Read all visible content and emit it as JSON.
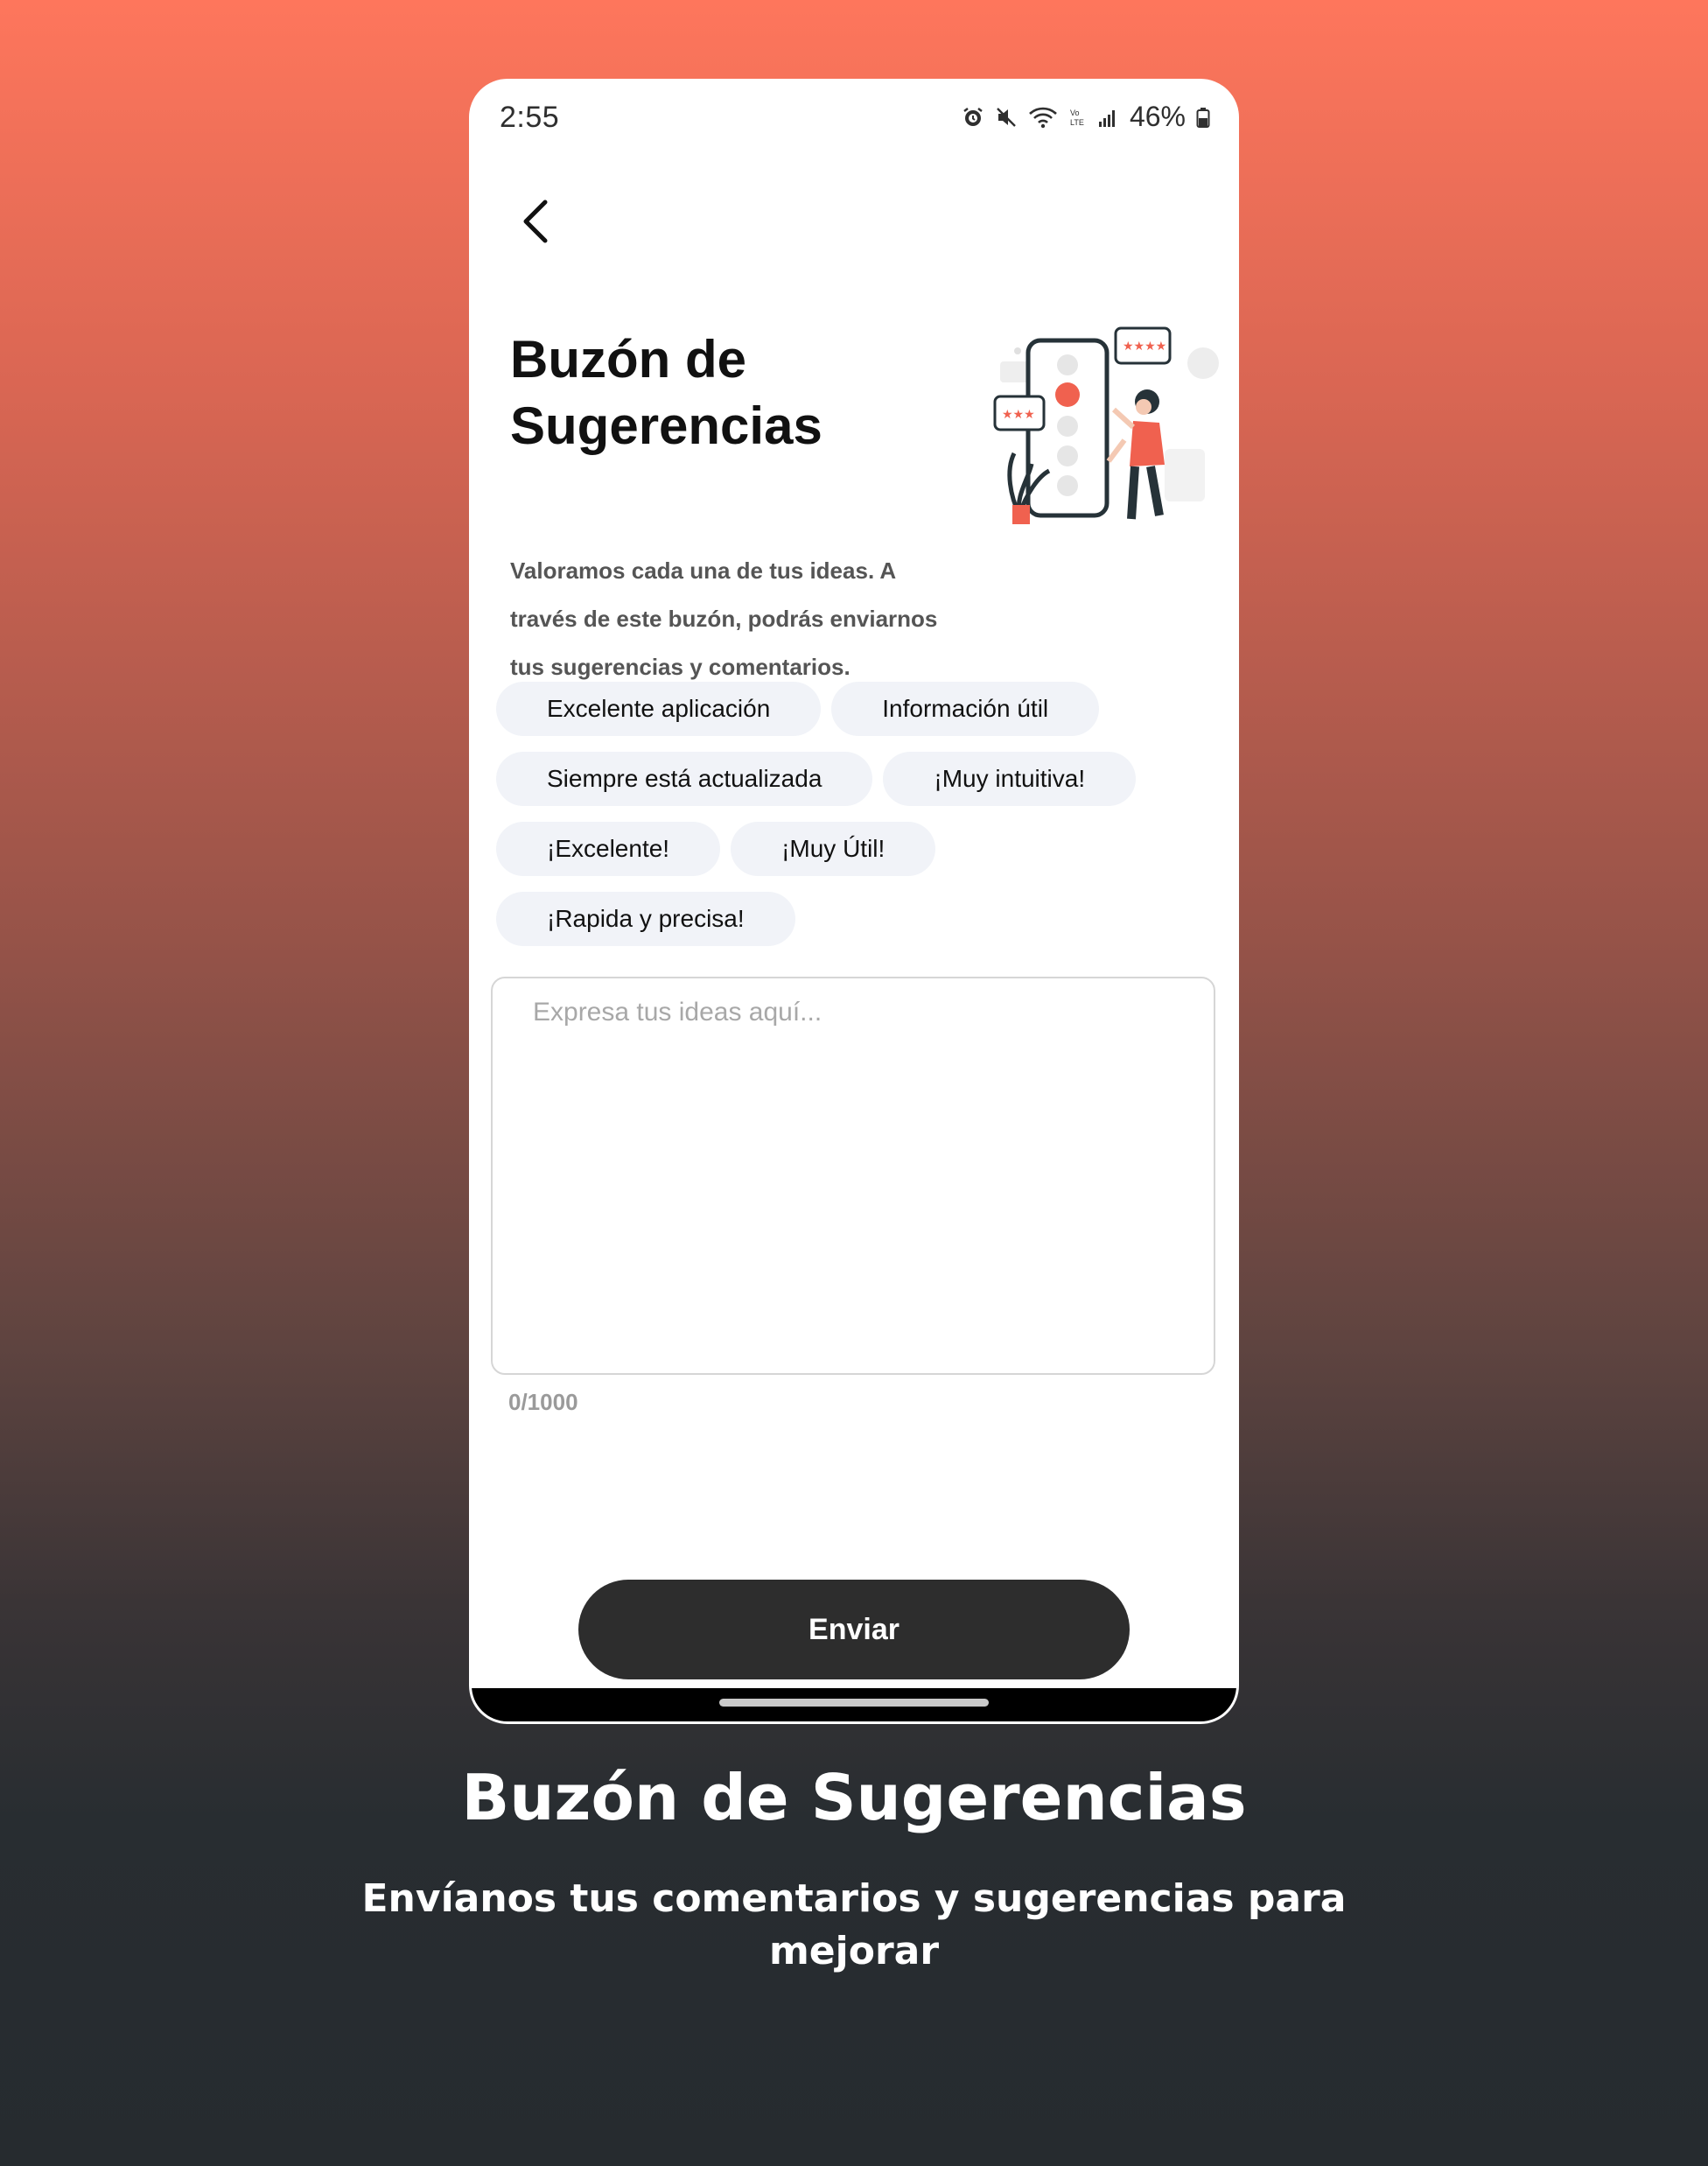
{
  "status_bar": {
    "time": "2:55",
    "battery": "46%",
    "icons": [
      "alarm-icon",
      "mute-icon",
      "wifi-icon",
      "volte-icon",
      "signal-icon",
      "battery-icon"
    ]
  },
  "header": {
    "back_icon": "chevron-left-icon",
    "title": "Buzón de Sugerencias",
    "description": "Valoramos cada una de tus ideas. A través de este buzón, podrás enviarnos tus sugerencias y comentarios."
  },
  "chips": [
    "Excelente aplicación",
    "Información útil",
    "Siempre está actualizada",
    "¡Muy intuitiva!",
    "¡Excelente!",
    "¡Muy Útil!",
    "¡Rapida y precisa!"
  ],
  "feedback": {
    "placeholder": "Expresa tus ideas aquí...",
    "value": "",
    "counter": "0/1000"
  },
  "submit_label": "Enviar",
  "promo": {
    "title": "Buzón de Sugerencias",
    "subtitle": "Envíanos tus comentarios y sugerencias para mejorar"
  },
  "colors": {
    "accent": "#f0614f",
    "button": "#2d2d2d",
    "chip_bg": "#f1f3f8",
    "gradient_top": "#fe765c",
    "gradient_bottom": "#262b2f"
  }
}
